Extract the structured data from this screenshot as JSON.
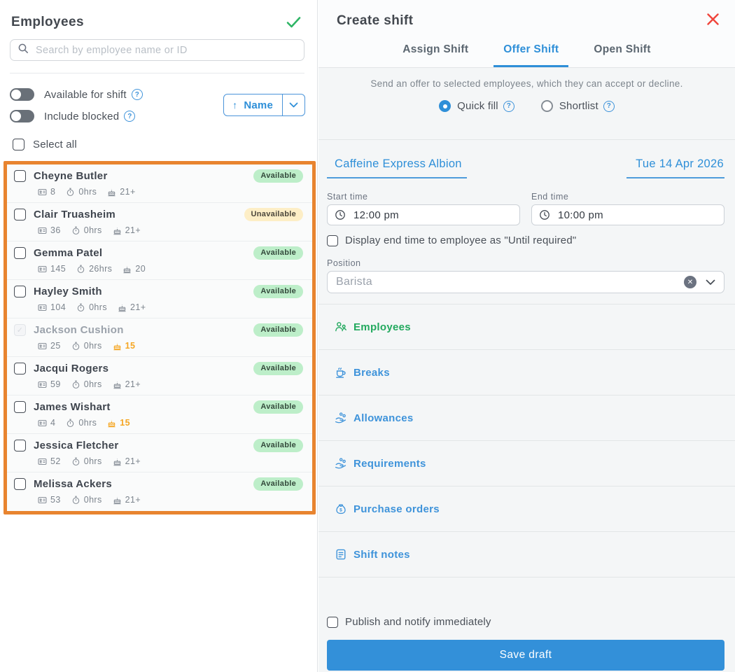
{
  "icons": {
    "question": "?",
    "arrow_up": "↑",
    "check": "✓",
    "clear_x": "✕"
  },
  "left_panel": {
    "title": "Employees",
    "search_placeholder": "Search by employee name or ID",
    "toggles": [
      {
        "label": "Available for shift",
        "on": false
      },
      {
        "label": "Include blocked",
        "on": false
      }
    ],
    "sort_label": "Name",
    "select_all_label": "Select all",
    "employees": [
      {
        "name": "Cheyne Butler",
        "status": "Available",
        "id": "8",
        "hours": "0hrs",
        "age": "21+"
      },
      {
        "name": "Clair Truasheim",
        "status": "Unavailable",
        "id": "36",
        "hours": "0hrs",
        "age": "21+"
      },
      {
        "name": "Gemma Patel",
        "status": "Available",
        "id": "145",
        "hours": "26hrs",
        "age": "20"
      },
      {
        "name": "Hayley Smith",
        "status": "Available",
        "id": "104",
        "hours": "0hrs",
        "age": "21+"
      },
      {
        "name": "Jackson Cushion",
        "status": "Available",
        "id": "25",
        "hours": "0hrs",
        "age": "15"
      },
      {
        "name": "Jacqui Rogers",
        "status": "Available",
        "id": "59",
        "hours": "0hrs",
        "age": "21+"
      },
      {
        "name": "James Wishart",
        "status": "Available",
        "id": "4",
        "hours": "0hrs",
        "age": "15"
      },
      {
        "name": "Jessica Fletcher",
        "status": "Available",
        "id": "52",
        "hours": "0hrs",
        "age": "21+"
      },
      {
        "name": "Melissa Ackers",
        "status": "Available",
        "id": "53",
        "hours": "0hrs",
        "age": "21+"
      }
    ]
  },
  "right_panel": {
    "title": "Create shift",
    "tabs": [
      {
        "label": "Assign Shift",
        "active": false
      },
      {
        "label": "Offer Shift",
        "active": true
      },
      {
        "label": "Open Shift",
        "active": false
      }
    ],
    "offer_description": "Send an offer to selected employees, which they can accept or decline.",
    "radios": [
      {
        "label": "Quick fill",
        "selected": true
      },
      {
        "label": "Shortlist",
        "selected": false
      }
    ],
    "location": "Caffeine Express Albion",
    "date": "Tue 14 Apr 2026",
    "start_time": {
      "label": "Start time",
      "value": "12:00 pm"
    },
    "end_time": {
      "label": "End time",
      "value": "10:00 pm"
    },
    "until_required_label": "Display end time to employee as \"Until required\"",
    "position_label": "Position",
    "position_value": "Barista",
    "sections": [
      {
        "label": "Employees"
      },
      {
        "label": "Breaks"
      },
      {
        "label": "Allowances"
      },
      {
        "label": "Requirements"
      },
      {
        "label": "Purchase orders"
      },
      {
        "label": "Shift notes"
      }
    ],
    "publish_label": "Publish and notify immediately",
    "save_label": "Save draft"
  },
  "colors": {
    "accent_blue": "#2e8fd8",
    "green": "#22a95e",
    "check_green": "#2eb565",
    "close_red": "#f0453c",
    "highlight_orange": "#e8842f",
    "warning_orange": "#f5a623",
    "available_bg": "#bdeec9",
    "unavailable_bg": "#fdeec6",
    "panel_gray": "#f4f6f7"
  }
}
